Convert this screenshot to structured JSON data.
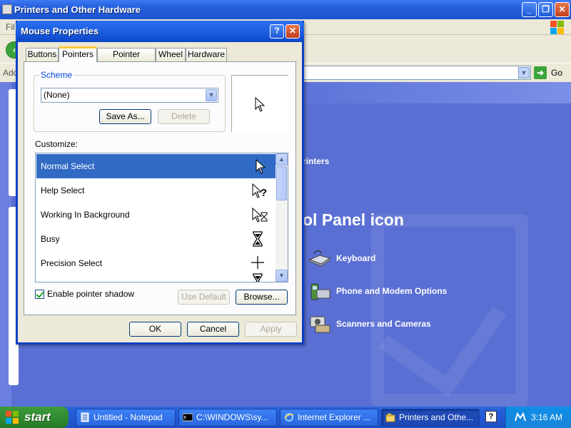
{
  "background_window": {
    "title": "Printers and Other Hardware",
    "menu_fragment": "Fil",
    "address_fragment": "Add",
    "go_label": "Go",
    "printers_fragment": "rinters",
    "control_panel_fragment": "ol Panel icon",
    "items": [
      {
        "label": "Keyboard",
        "icon": "keyboard-icon"
      },
      {
        "label": "Phone and Modem Options",
        "icon": "phone-icon"
      },
      {
        "label": "Scanners and Cameras",
        "icon": "scanner-icon"
      }
    ]
  },
  "dialog": {
    "title": "Mouse Properties",
    "tabs": [
      {
        "label": "Buttons"
      },
      {
        "label": "Pointers",
        "active": true
      },
      {
        "label": "Pointer Options"
      },
      {
        "label": "Wheel"
      },
      {
        "label": "Hardware"
      }
    ],
    "scheme": {
      "legend": "Scheme",
      "selected": "(None)",
      "save_as": "Save As...",
      "delete": "Delete"
    },
    "customize_label": "Customize:",
    "cursors": [
      {
        "label": "Normal Select",
        "icon": "arrow-cursor-icon",
        "selected": true
      },
      {
        "label": "Help Select",
        "icon": "help-cursor-icon"
      },
      {
        "label": "Working In Background",
        "icon": "working-cursor-icon"
      },
      {
        "label": "Busy",
        "icon": "hourglass-icon"
      },
      {
        "label": "Precision Select",
        "icon": "crosshair-icon"
      },
      {
        "label": "",
        "icon": "hourglass-icon"
      }
    ],
    "enable_shadow": {
      "label": "Enable pointer shadow",
      "checked": true
    },
    "use_default": "Use Default",
    "browse": "Browse...",
    "ok": "OK",
    "cancel": "Cancel",
    "apply": "Apply"
  },
  "taskbar": {
    "start": "start",
    "tasks": [
      {
        "label": "Untitled - Notepad",
        "icon": "notepad-icon"
      },
      {
        "label": "C:\\WINDOWS\\sy...",
        "icon": "cmd-icon"
      },
      {
        "label": "Internet Explorer ...",
        "icon": "ie-icon"
      },
      {
        "label": "Printers and Othe...",
        "icon": "folder-icon",
        "active": true
      }
    ],
    "clock": "3:16 AM"
  }
}
